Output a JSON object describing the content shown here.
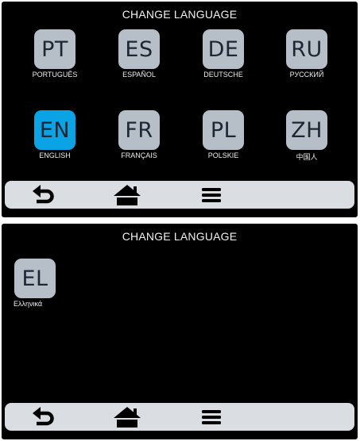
{
  "screen1": {
    "title": "CHANGE LANGUAGE",
    "languages": [
      {
        "code": "PT",
        "name": "PORTUGUÊS",
        "selected": false
      },
      {
        "code": "ES",
        "name": "ESPAÑOL",
        "selected": false
      },
      {
        "code": "DE",
        "name": "DEUTSCHE",
        "selected": false
      },
      {
        "code": "RU",
        "name": "РУССКИЙ",
        "selected": false
      },
      {
        "code": "EN",
        "name": "ENGLISH",
        "selected": true
      },
      {
        "code": "FR",
        "name": "FRANÇAIS",
        "selected": false
      },
      {
        "code": "PL",
        "name": "POLSKIE",
        "selected": false
      },
      {
        "code": "ZH",
        "name": "中国人",
        "selected": false
      }
    ]
  },
  "screen2": {
    "title": "CHANGE LANGUAGE",
    "languages": [
      {
        "code": "EL",
        "name": "Ελληνικά",
        "selected": false
      }
    ]
  },
  "navbar": {
    "buttons": [
      {
        "icon": "back-arrow-icon"
      },
      {
        "icon": "home-icon"
      },
      {
        "icon": "menu-icon"
      }
    ]
  },
  "colors": {
    "screen_bg": "#000000",
    "tile": "#b6bec8",
    "tile_selected": "#0aa3e6",
    "tile_text": "#1c2733",
    "navbar": "#dadde1"
  }
}
